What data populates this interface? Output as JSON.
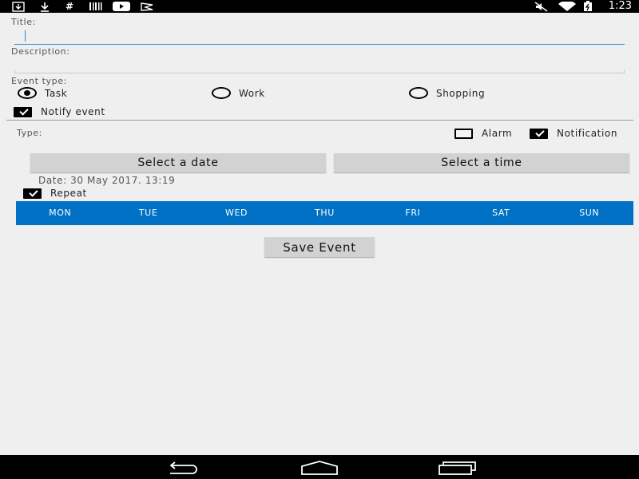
{
  "status_bar": {
    "time": "1:23",
    "left_icons": [
      "download-box-icon",
      "download-icon",
      "hashtag-icon",
      "barcode-icon",
      "youtube-icon",
      "flag-icon"
    ],
    "right_icons": [
      "muted-icon",
      "wifi-icon",
      "battery-charging-icon"
    ]
  },
  "form": {
    "title_label": "Title:",
    "title_value": "",
    "description_label": "Description:",
    "description_value": "",
    "event_type_label": "Event type:",
    "event_types": [
      "Task",
      "Work",
      "Shopping"
    ],
    "event_type_selected": "Task",
    "notify_label": "Notify event",
    "notify_checked": true,
    "type_label": "Type:",
    "alarm_label": "Alarm",
    "alarm_checked": false,
    "notification_label": "Notification",
    "notification_checked": true,
    "select_date_label": "Select a date",
    "select_time_label": "Select a time",
    "date_text": "Date: 30 May 2017. 13:19",
    "repeat_label": "Repeat",
    "repeat_checked": true,
    "days": [
      "MON",
      "TUE",
      "WED",
      "THU",
      "FRI",
      "SAT",
      "SUN"
    ],
    "save_label": "Save Event"
  },
  "colors": {
    "accent": "#1a8fd6",
    "days_bar": "#0071c5",
    "background": "#efefef",
    "button": "#d2d2d2"
  },
  "nav_bar": {
    "buttons": [
      "back-icon",
      "home-icon",
      "recents-icon"
    ]
  }
}
